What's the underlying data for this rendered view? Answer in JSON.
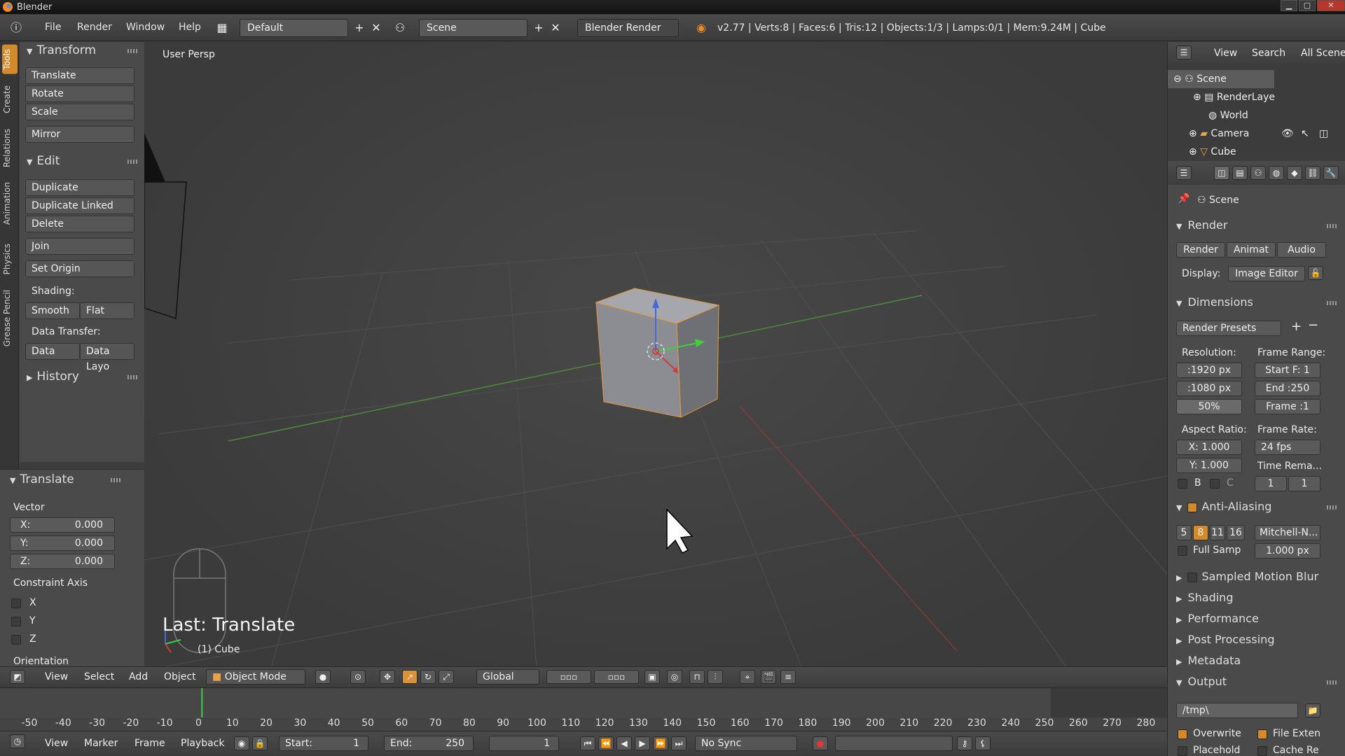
{
  "window": {
    "title": "Blender",
    "minimize": "▁",
    "maximize": "▢",
    "close": "✕"
  },
  "infobar": {
    "menus": [
      "File",
      "Render",
      "Window",
      "Help"
    ],
    "layout": "Default",
    "scene": "Scene",
    "engine": "Blender Render",
    "stats": "v2.77 | Verts:8 | Faces:6 | Tris:12 | Objects:1/3 | Lamps:0/1 | Mem:9.24M | Cube"
  },
  "vtabs": [
    "Tools",
    "Create",
    "Relations",
    "Animation",
    "Physics",
    "Grease Pencil"
  ],
  "toolshelf": {
    "transform": {
      "title": "Transform",
      "items": [
        "Translate",
        "Rotate",
        "Scale",
        "Mirror"
      ]
    },
    "edit": {
      "title": "Edit",
      "items": [
        "Duplicate",
        "Duplicate Linked",
        "Delete",
        "Join",
        "Set Origin"
      ],
      "shading_label": "Shading:",
      "smooth": "Smooth",
      "flat": "Flat",
      "data_transfer_label": "Data Transfer:",
      "data": "Data",
      "data_layo": "Data Layo"
    },
    "history": {
      "title": "History"
    }
  },
  "operator": {
    "title": "Translate",
    "vector_label": "Vector",
    "x_label": "X:",
    "x": "0.000",
    "y_label": "Y:",
    "y": "0.000",
    "z_label": "Z:",
    "z": "0.000",
    "constraint_label": "Constraint Axis",
    "axes": [
      "X",
      "Y",
      "Z"
    ],
    "orientation_label": "Orientation"
  },
  "viewport": {
    "title": "User Persp",
    "last_op": "Last: Translate",
    "object": "(1) Cube"
  },
  "viewport_header": {
    "menus": [
      "View",
      "Select",
      "Add",
      "Object"
    ],
    "mode": "Object Mode",
    "orientation": "Global"
  },
  "timeline": {
    "ticks": [
      "-50",
      "-40",
      "-30",
      "-20",
      "-10",
      "0",
      "10",
      "20",
      "30",
      "40",
      "50",
      "60",
      "70",
      "80",
      "90",
      "100",
      "110",
      "120",
      "130",
      "140",
      "150",
      "160",
      "170",
      "180",
      "190",
      "200",
      "210",
      "220",
      "230",
      "240",
      "250",
      "260",
      "270",
      "280"
    ],
    "current_frame": 1,
    "menus": [
      "View",
      "Marker",
      "Frame",
      "Playback"
    ],
    "start_label": "Start:",
    "start": "1",
    "end_label": "End:",
    "end": "250",
    "frame": "1",
    "sync": "No Sync"
  },
  "outliner": {
    "menus": [
      "View",
      "Search",
      "All Scenes"
    ],
    "rows": [
      "Scene",
      "RenderLaye",
      "World",
      "Camera",
      "Cube"
    ]
  },
  "properties": {
    "context": "Scene",
    "render": {
      "title": "Render",
      "render_btn": "Render",
      "anim_btn": "Animat",
      "audio_btn": "Audio",
      "display_label": "Display:",
      "display": "Image Editor"
    },
    "dimensions": {
      "title": "Dimensions",
      "presets": "Render Presets",
      "resolution_label": "Resolution:",
      "res_x": ":1920 px",
      "res_y": ":1080 px",
      "res_pct": "50%",
      "frame_range_label": "Frame Range:",
      "start": "Start F: 1",
      "end": "End :250",
      "frame": "Frame :1",
      "aspect_label": "Aspect Ratio:",
      "aspect_x": "X:  1.000",
      "aspect_y": "Y:  1.000",
      "frame_rate_label": "Frame Rate:",
      "fps": "24 fps",
      "time_remap": "Time Rema...",
      "b": "B",
      "c": "C",
      "remap_old": "1",
      "remap_new": "1"
    },
    "anti_aliasing": {
      "title": "Anti-Aliasing",
      "samples": [
        "5",
        "8",
        "11",
        "16"
      ],
      "filter": "Mitchell-N...",
      "full_sample": "Full Samp",
      "size": "1.000 px"
    },
    "sections": [
      "Sampled Motion Blur",
      "Shading",
      "Performance",
      "Post Processing",
      "Metadata"
    ],
    "output": {
      "title": "Output",
      "path": "/tmp\\",
      "overwrite": "Overwrite",
      "file_ext": "File Exten",
      "placeholders": "Placehold",
      "cache": "Cache Re"
    }
  }
}
